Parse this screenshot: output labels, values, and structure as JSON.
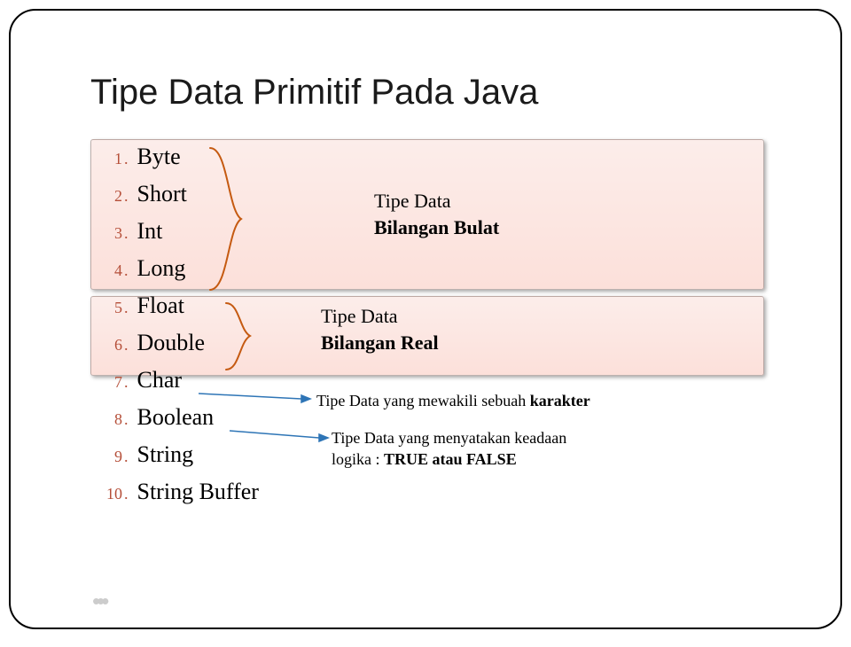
{
  "title": "Tipe Data Primitif Pada Java",
  "items": [
    {
      "n": "1",
      "label": "Byte"
    },
    {
      "n": "2",
      "label": "Short"
    },
    {
      "n": "3",
      "label": "Int"
    },
    {
      "n": "4",
      "label": "Long"
    },
    {
      "n": "5",
      "label": "Float"
    },
    {
      "n": "6",
      "label": "Double"
    },
    {
      "n": "7",
      "label": "Char"
    },
    {
      "n": "8",
      "label": "Boolean"
    },
    {
      "n": "9",
      "label": "String"
    },
    {
      "n": "10",
      "label": "String Buffer"
    }
  ],
  "group1": {
    "l1": "Tipe Data",
    "l2": "Bilangan Bulat"
  },
  "group2": {
    "l1": "Tipe Data",
    "l2": "Bilangan Real"
  },
  "note_char": {
    "prefix": "Tipe Data yang mewakili sebuah ",
    "bold": "karakter"
  },
  "note_bool": {
    "line1": "Tipe Data yang menyatakan keadaan",
    "line2_prefix": "logika : ",
    "line2_bold": "TRUE atau FALSE"
  }
}
